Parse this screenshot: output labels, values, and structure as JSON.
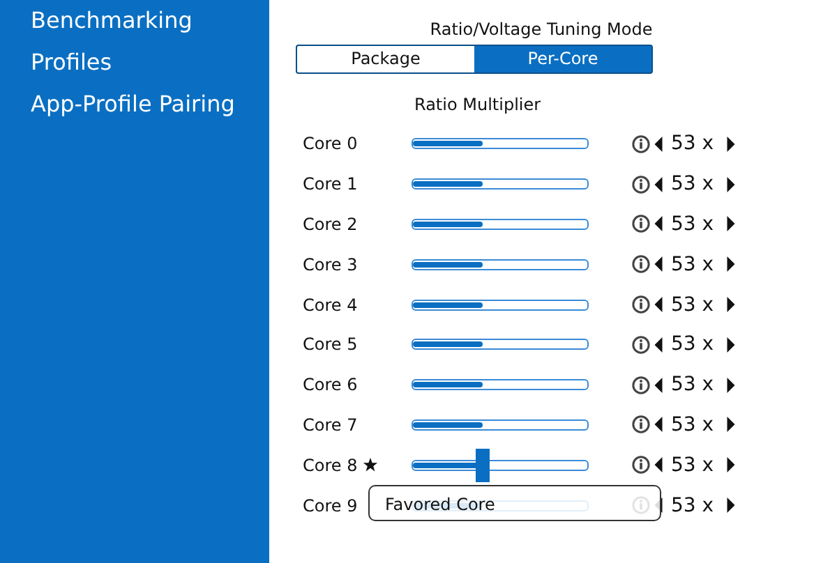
{
  "sidebar": {
    "items": [
      {
        "label": "Benchmarking"
      },
      {
        "label": "Profiles"
      },
      {
        "label": "App-Profile Pairing"
      }
    ]
  },
  "tuning_mode": {
    "title": "Ratio/Voltage Tuning Mode",
    "options": [
      {
        "label": "Package",
        "selected": false
      },
      {
        "label": "Per-Core",
        "selected": true
      }
    ]
  },
  "ratio_multiplier": {
    "title": "Ratio Multiplier",
    "cores": [
      {
        "name": "Core 0",
        "level": 0.4,
        "value": "53 x",
        "favored": false,
        "selected": false
      },
      {
        "name": "Core 1",
        "level": 0.4,
        "value": "53 x",
        "favored": false,
        "selected": false
      },
      {
        "name": "Core 2",
        "level": 0.4,
        "value": "53 x",
        "favored": false,
        "selected": false
      },
      {
        "name": "Core 3",
        "level": 0.4,
        "value": "53 x",
        "favored": false,
        "selected": false
      },
      {
        "name": "Core 4",
        "level": 0.4,
        "value": "53 x",
        "favored": false,
        "selected": false
      },
      {
        "name": "Core 5",
        "level": 0.4,
        "value": "53 x",
        "favored": false,
        "selected": false
      },
      {
        "name": "Core 6",
        "level": 0.4,
        "value": "53 x",
        "favored": false,
        "selected": false
      },
      {
        "name": "Core 7",
        "level": 0.4,
        "value": "53 x",
        "favored": false,
        "selected": false
      },
      {
        "name": "Core 8",
        "level": 0.4,
        "value": "53 x",
        "favored": true,
        "selected": true
      },
      {
        "name": "Core 9",
        "level": 0.4,
        "value": "53 x",
        "favored": false,
        "selected": false
      }
    ]
  },
  "tooltip": {
    "text": "Favored Core"
  }
}
